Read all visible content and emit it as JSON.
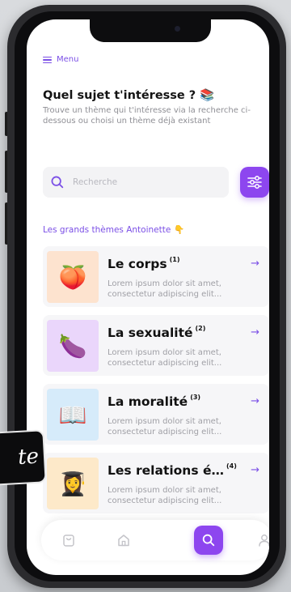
{
  "menu": {
    "label": "Menu"
  },
  "header": {
    "title": "Quel sujet t'intéresse ?",
    "title_emoji": "📚",
    "subtitle": "Trouve un thème qui t'intéresse via la recherche ci-dessous ou choisi un thème déjà existant"
  },
  "search": {
    "placeholder": "Recherche"
  },
  "section": {
    "label": "Les grands thèmes Antoinette",
    "emoji": "👇"
  },
  "themes": [
    {
      "title": "Le corps",
      "number": "(1)",
      "description": "Lorem ipsum dolor sit amet, consectetur adipiscing elit...",
      "emoji": "🍑",
      "thumb_color": "#fde3cf",
      "arrow": "→"
    },
    {
      "title": "La sexualité",
      "number": "(2)",
      "description": "Lorem ipsum dolor sit amet, consectetur adipiscing elit...",
      "emoji": "🍆",
      "thumb_color": "#ead6fb",
      "arrow": "→"
    },
    {
      "title": "La moralité",
      "number": "(3)",
      "description": "Lorem ipsum dolor sit amet, consectetur adipiscing elit...",
      "emoji": "📖",
      "thumb_color": "#d6ebfa",
      "arrow": "→"
    },
    {
      "title": "Les relations é…",
      "number": "(4)",
      "description": "Lorem ipsum dolor sit amet, consectetur adipiscing elit...",
      "emoji": "👩‍🎓",
      "thumb_color": "#fde9c9",
      "arrow": "→"
    }
  ],
  "nav": {
    "items": [
      "shopping-bag",
      "home",
      "search",
      "profile"
    ],
    "active": "search"
  },
  "overlay": {
    "text": "te"
  },
  "colors": {
    "accent": "#8d46ef",
    "text": "#141414",
    "muted": "#a0a0a6"
  }
}
